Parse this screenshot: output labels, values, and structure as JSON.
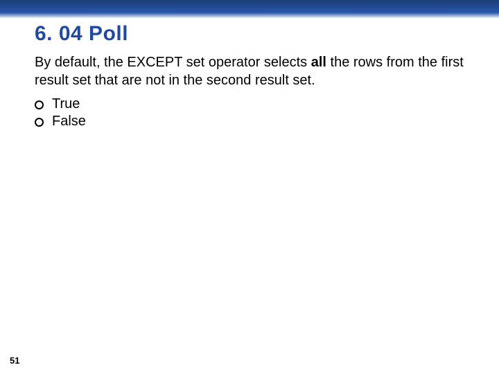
{
  "slide": {
    "title": "6. 04 Poll",
    "question_pre": "By default, the EXCEPT set operator selects ",
    "question_bold": "all",
    "question_post": " the rows from the first result set that are not in the second result set.",
    "options": [
      "True",
      "False"
    ],
    "page_number": "51"
  }
}
